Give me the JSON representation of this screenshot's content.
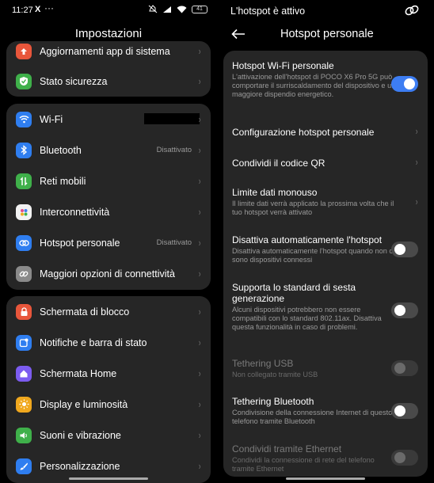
{
  "left": {
    "status": {
      "time": "11:27",
      "x_icon": "X",
      "dots": "···",
      "battery": "41"
    },
    "title": "Impostazioni",
    "card1": [
      {
        "label": "Aggiornamenti app di sistema",
        "icon": "update-icon",
        "color": "#e8563b"
      },
      {
        "label": "Stato sicurezza",
        "icon": "shield-icon",
        "color": "#3fb04a"
      }
    ],
    "card2": [
      {
        "label": "Wi-Fi",
        "value": "",
        "icon": "wifi-icon",
        "color": "#2f7ef0"
      },
      {
        "label": "Bluetooth",
        "value": "Disattivato",
        "icon": "bluetooth-icon",
        "color": "#2f7ef0"
      },
      {
        "label": "Reti mobili",
        "value": "",
        "icon": "mobile-data-icon",
        "color": "#3fb04a"
      },
      {
        "label": "Interconnettività",
        "value": "",
        "icon": "interconnect-icon",
        "color": "#f2f2f2"
      },
      {
        "label": "Hotspot personale",
        "value": "Disattivato",
        "icon": "hotspot-icon",
        "color": "#2f7ef0"
      },
      {
        "label": "Maggiori opzioni di connettività",
        "value": "",
        "icon": "link-icon",
        "color": "#8a8a8a"
      }
    ],
    "card3": [
      {
        "label": "Schermata di blocco",
        "icon": "lock-icon",
        "color": "#e8563b"
      },
      {
        "label": "Notifiche e barra di stato",
        "icon": "notification-icon",
        "color": "#2f7ef0"
      },
      {
        "label": "Schermata Home",
        "icon": "home-icon",
        "color": "#7c5cf0"
      },
      {
        "label": "Display e luminosità",
        "icon": "sun-icon",
        "color": "#f0a81e"
      },
      {
        "label": "Suoni e vibrazione",
        "icon": "sound-icon",
        "color": "#3fb04a"
      },
      {
        "label": "Personalizzazione",
        "icon": "brush-icon",
        "color": "#2f7ef0"
      }
    ]
  },
  "right": {
    "status_title": "L'hotspot è attivo",
    "title": "Hotspot personale",
    "items": [
      {
        "title": "Hotspot Wi-Fi personale",
        "desc": "L'attivazione dell'hotspot di POCO X6 Pro 5G può comportare il surriscaldamento del dispositivo e un maggiore dispendio energetico.",
        "control": "toggle",
        "state": "on"
      },
      {
        "title": "Configurazione hotspot personale",
        "desc": "",
        "control": "chevron"
      },
      {
        "title": "Condividi il codice QR",
        "desc": "",
        "control": "chevron"
      },
      {
        "title": "Limite dati monouso",
        "desc": "Il limite dati verrà applicato la prossima volta che il tuo hotspot verrà attivato",
        "control": "chevron"
      },
      {
        "title": "Disattiva automaticamente l'hotspot",
        "desc": "Disattiva automaticamente l'hotspot quando non ci sono dispositivi connessi",
        "control": "toggle",
        "state": "off"
      },
      {
        "title": "Supporta lo standard di sesta generazione",
        "desc": "Alcuni dispositivi potrebbero non essere compatibili con lo standard 802.11ax. Disattiva questa funzionalità in caso di problemi.",
        "control": "toggle",
        "state": "off"
      },
      {
        "title": "Tethering USB",
        "desc": "Non collegato tramite USB",
        "control": "toggle",
        "state": "disabled"
      },
      {
        "title": "Tethering Bluetooth",
        "desc": "Condivisione della connessione Internet di questo telefono tramite Bluetooth",
        "control": "toggle",
        "state": "off"
      },
      {
        "title": "Condividi tramite Ethernet",
        "desc": "Condividi la connessione di rete del telefono tramite Ethernet",
        "control": "toggle",
        "state": "disabled"
      }
    ]
  }
}
